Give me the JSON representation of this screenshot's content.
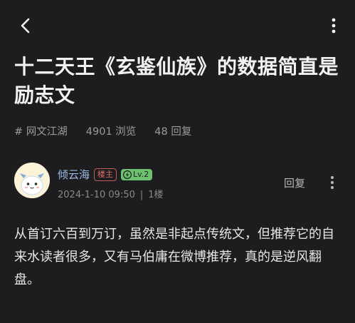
{
  "header": {
    "back_icon": "chevron-left-icon",
    "more_icon": "vertical-dots-icon"
  },
  "post": {
    "title": "十二天王《玄鉴仙族》的数据简直是励志文",
    "tag": "# 网文江湖",
    "views": "4901 浏览",
    "replies": "48 回复"
  },
  "author": {
    "name": "倾云海",
    "host_badge": "楼主",
    "level_badge": "Lv.2",
    "date": "2024-1-10 09:50",
    "separator": "|",
    "floor": "1楼",
    "reply_label": "回复",
    "name_color": "#9dbde6",
    "host_badge_color": "#e26a6a",
    "level_badge_color": "#6cc26e"
  },
  "content": {
    "text": "从首订六百到万订，虽然是非起点传统文，但推荐它的自来水读者很多，又有马伯庸在微博推荐，真的是逆风翻盘。"
  },
  "theme": {
    "background": "#1d1d1f",
    "text": "#e8e8e8",
    "muted": "#9a9a9a"
  }
}
